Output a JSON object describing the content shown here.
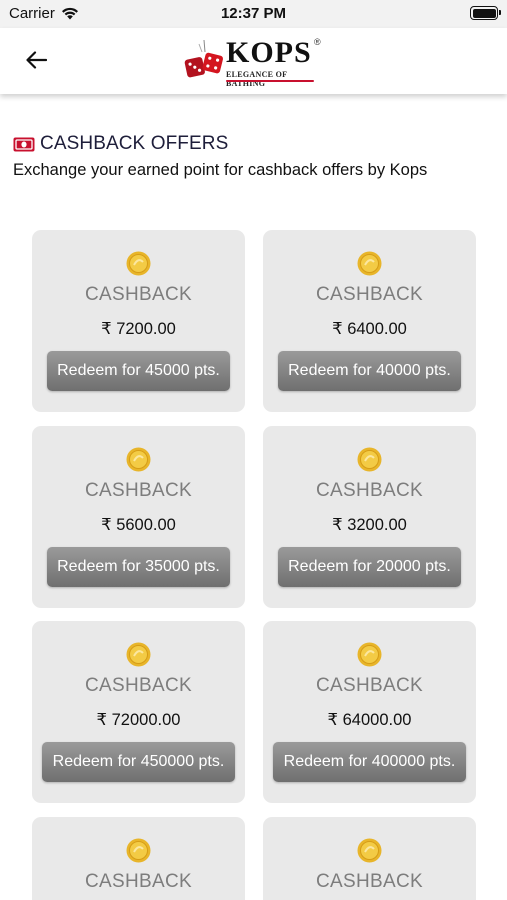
{
  "status_bar": {
    "carrier": "Carrier",
    "time": "12:37 PM",
    "icons": [
      "wifi-icon",
      "battery-icon"
    ]
  },
  "nav": {
    "back_icon": "back-arrow-icon",
    "logo": {
      "brand": "KOPS",
      "registered": "®",
      "tagline": "ELEGANCE OF BATHING"
    }
  },
  "section": {
    "icon": "cash-note-icon",
    "title": "CASHBACK OFFERS",
    "subtitle": "Exchange your earned point for cashback offers by Kops"
  },
  "colors": {
    "accent_red": "#c8102e",
    "card_bg": "#e9e9e9",
    "button_gray": "#7f7f7f",
    "title_gray": "#7d7d7d",
    "coin_gold": "#e8b52a"
  },
  "offers": [
    {
      "title": "CASHBACK",
      "amount": "₹ 7200.00",
      "button": "Redeem for 45000 pts."
    },
    {
      "title": "CASHBACK",
      "amount": "₹ 6400.00",
      "button": "Redeem for 40000 pts."
    },
    {
      "title": "CASHBACK",
      "amount": "₹ 5600.00",
      "button": "Redeem for 35000 pts."
    },
    {
      "title": "CASHBACK",
      "amount": "₹ 3200.00",
      "button": "Redeem for 20000 pts."
    },
    {
      "title": "CASHBACK",
      "amount": "₹ 72000.00",
      "button": "Redeem for 450000 pts."
    },
    {
      "title": "CASHBACK",
      "amount": "₹ 64000.00",
      "button": "Redeem for 400000 pts."
    },
    {
      "title": "CASHBACK"
    },
    {
      "title": "CASHBACK"
    }
  ]
}
